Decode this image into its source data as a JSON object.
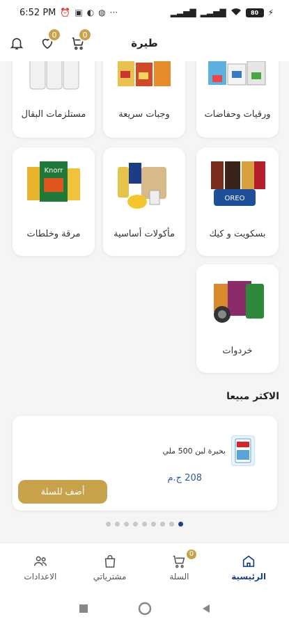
{
  "status_bar": {
    "time": "6:52 PM",
    "battery": "80"
  },
  "app_bar": {
    "title": "طيرة",
    "cart_count": "0",
    "favorites_count": "0"
  },
  "categories": [
    {
      "label": "ورقيات وحفاضات",
      "icon": "tissue-diaper-products-image"
    },
    {
      "label": "وجبات سريعة",
      "icon": "fast-food-products-image"
    },
    {
      "label": "مستلزمات البقال",
      "icon": "grocer-supplies-image"
    },
    {
      "label": "بسكويت و كيك",
      "icon": "biscuits-cake-products-image"
    },
    {
      "label": "مأكولات أساسية",
      "icon": "staple-foods-image"
    },
    {
      "label": "مرقة وخلطات",
      "icon": "broth-mixes-image"
    },
    {
      "label": "خردوات",
      "icon": "hardware-sundries-image"
    }
  ],
  "best_sellers": {
    "title": "الاكثر مبيعا",
    "product": {
      "name": "بخيرة لبن 500 ملي",
      "price": "208 ج.م",
      "add_button": "أضف للسلة"
    },
    "slides": {
      "count": 9,
      "active": 0
    }
  },
  "bottom_nav": [
    {
      "label": "الرئيسية",
      "icon": "home-icon",
      "active": true
    },
    {
      "label": "السلة",
      "icon": "cart-icon",
      "badge": "0"
    },
    {
      "label": "مشترياتي",
      "icon": "shopping-bag-icon"
    },
    {
      "label": "الاعدادات",
      "icon": "settings-users-icon"
    }
  ],
  "colors": {
    "accent": "#c8a24b",
    "primary": "#1b3f8f",
    "price": "#2d5b9a"
  }
}
